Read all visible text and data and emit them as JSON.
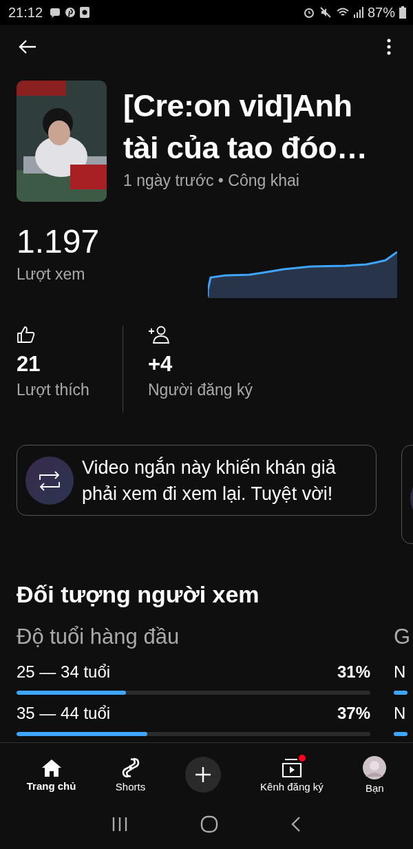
{
  "status_bar": {
    "time": "21:12",
    "battery": "87%"
  },
  "video": {
    "title": "[Cre:on vid]Anh tài của tao đóo…",
    "meta": "1 ngày trước • Công khai"
  },
  "views": {
    "value": "1.197",
    "label": "Lượt xem"
  },
  "stats": [
    {
      "kind": "likes",
      "value": "21",
      "label": "Lượt thích"
    },
    {
      "kind": "subscribers",
      "value": "+4",
      "label": "Người đăng ký"
    }
  ],
  "insight": {
    "text": "Video ngắn này khiến khán giả phải xem đi xem lại. Tuyệt vời!"
  },
  "audience": {
    "heading": "Đối tượng người xem",
    "title": "Độ tuổi hàng đầu",
    "rows": [
      {
        "label": "25 — 34 tuổi",
        "value": "31%",
        "level": 0.31
      },
      {
        "label": "35 — 44 tuổi",
        "value": "37%",
        "level": 0.37
      }
    ],
    "next_column": {
      "title": "G",
      "rows": [
        "N",
        "N"
      ]
    }
  },
  "nav": [
    {
      "kind": "home",
      "label": "Trang chủ",
      "selected": true
    },
    {
      "kind": "shorts",
      "label": "Shorts",
      "selected": false
    },
    {
      "kind": "create"
    },
    {
      "kind": "subscriptions",
      "label": "Kênh đăng ký",
      "selected": false,
      "badge": true
    },
    {
      "kind": "you",
      "label": "Bạn",
      "selected": false
    }
  ]
}
